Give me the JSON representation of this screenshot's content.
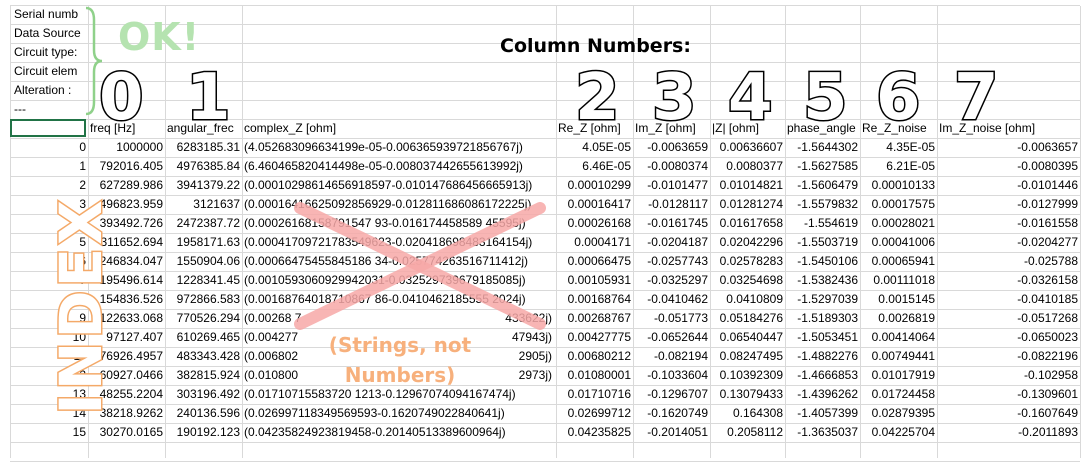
{
  "meta_rows": [
    "Serial numb",
    "Data Source",
    "Circuit type:",
    "Circuit elem",
    "Alteration :",
    "---"
  ],
  "annotations": {
    "ok_label": "OK!",
    "column_numbers_title": "Column Numbers:",
    "column_digits": [
      "0",
      "1",
      "2",
      "3",
      "4",
      "5",
      "6",
      "7"
    ],
    "index_label": "INDEX",
    "strings_note_line1": "(Strings, not",
    "strings_note_line2": "Numbers)",
    "colors": {
      "ok": "#b5e3b0",
      "index": "#f4a968",
      "strings": "#f7b07c",
      "cross": "#f7a9a8"
    }
  },
  "headers": [
    "freq [Hz]",
    "angular_frec",
    "complex_Z [ohm]",
    "Re_Z [ohm]",
    "Im_Z [ohm]",
    "|Z| [ohm]",
    "phase_angle",
    "Re_Z_noise",
    "Im_Z_noise [ohm]"
  ],
  "rows": [
    [
      "0",
      "1000000",
      "6283185.31",
      "(4.052683096634199e-05-0.006365939721856767j)",
      "4.05E-05",
      "-0.0063659",
      "0.00636607",
      "-1.5644302",
      "4.35E-05",
      "-0.0063657"
    ],
    [
      "1",
      "792016.405",
      "4976385.84",
      "(6.460465820414498e-05-0.008037442655613992j)",
      "6.46E-05",
      "-0.0080374",
      "0.0080377",
      "-1.5627585",
      "6.21E-05",
      "-0.0080395"
    ],
    [
      "2",
      "627289.986",
      "3941379.22",
      "(0.00010298614656918597-0.010147686456665913j)",
      "0.00010299",
      "-0.0101477",
      "0.01014821",
      "-1.5606479",
      "0.00010133",
      "-0.0101446"
    ],
    [
      "3",
      "496823.959",
      "3121637",
      "(0.00016416625092856929-0.012811686086172225j)",
      "0.00016417",
      "-0.0128117",
      "0.01281274",
      "-1.5579832",
      "0.00017575",
      "-0.0127999"
    ],
    [
      "4",
      "393492.726",
      "2472387.72",
      "(0.00026168158791547 93-0.016174458589 45595j)",
      "0.00026168",
      "-0.0161745",
      "0.01617658",
      "-1.554619",
      "0.00028021",
      "-0.0161558"
    ],
    [
      "5",
      "311652.694",
      "1958171.63",
      "(0.00041709721783549623-0.020418698483164154j)",
      "0.0004171",
      "-0.0204187",
      "0.02042296",
      "-1.5503719",
      "0.00041006",
      "-0.0204277"
    ],
    [
      "6",
      "246834.047",
      "1550904.06",
      "(0.00066475455845186 34-0.025774263516711412j)",
      "0.00066475",
      "-0.0257743",
      "0.02578283",
      "-1.5450106",
      "0.00065941",
      "-0.025788"
    ],
    [
      "7",
      "195496.614",
      "1228341.45",
      "(0.0010593060929942031-0.032529739679185085j)",
      "0.00105931",
      "-0.0325297",
      "0.03254698",
      "-1.5382436",
      "0.00111018",
      "-0.0326158"
    ],
    [
      "8",
      "154836.526",
      "972866.583",
      "(0.00168764018710867 86-0.0410462185555 2024j)",
      "0.00168764",
      "-0.0410462",
      "0.0410809",
      "-1.5297039",
      "0.0015145",
      "-0.0410185"
    ],
    [
      "9",
      "122633.068",
      "770526.294",
      "(0.00268 7",
      "0.00268767",
      "-0.051773",
      "0.05184276",
      "-1.5189303",
      "0.0026819",
      "-0.0517268"
    ],
    [
      "10",
      "97127.407",
      "610269.465",
      "(0.004277",
      "0.00427775",
      "-0.0652644",
      "0.06540447",
      "-1.5053451",
      "0.00414064",
      "-0.0650023"
    ],
    [
      "11",
      "76926.4957",
      "483343.428",
      "(0.006802",
      "0.00680212",
      "-0.082194",
      "0.08247495",
      "-1.4882276",
      "0.00749441",
      "-0.0822196"
    ],
    [
      "12",
      "60927.0466",
      "382815.924",
      "(0.010800",
      "0.01080001",
      "-0.1033604",
      "0.10392309",
      "-1.4666853",
      "0.01017919",
      "-0.102958"
    ],
    [
      "13",
      "48255.2204",
      "303196.492",
      "(0.01710715583720 1213-0.12967074094167474j)",
      "0.01710716",
      "-0.1296707",
      "0.13079433",
      "-1.4396262",
      "0.01724458",
      "-0.1309601"
    ],
    [
      "14",
      "38218.9262",
      "240136.596",
      "(0.026997118349569593-0.1620749022840641j)",
      "0.02699712",
      "-0.1620749",
      "0.164308",
      "-1.4057399",
      "0.02879395",
      "-0.1607649"
    ],
    [
      "15",
      "30270.0165",
      "190192.123",
      "(0.04235824923819458-0.20140513389600964j)",
      "0.04235825",
      "-0.2014051",
      "0.2058112",
      "-1.3635037",
      "0.04225704",
      "-0.2011893"
    ]
  ],
  "tails_right_of_note": [
    "433622j)",
    "47943j)",
    "2905j)",
    "2973j)"
  ]
}
